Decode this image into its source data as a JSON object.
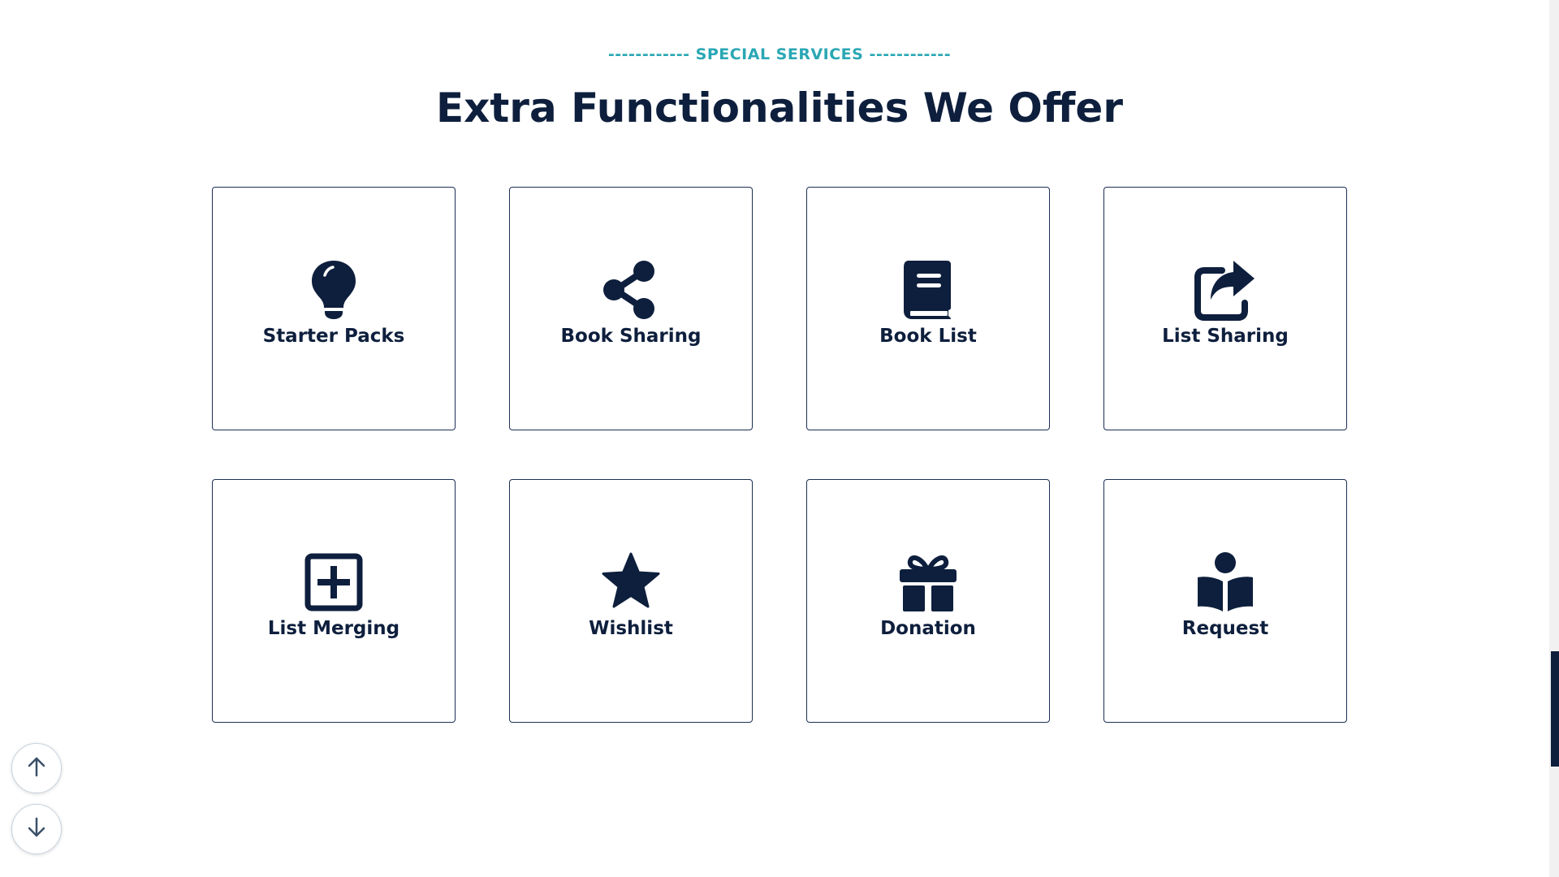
{
  "section": {
    "eyebrow": "------------ SPECIAL SERVICES ------------",
    "title": "Extra Functionalities We Offer"
  },
  "services": [
    {
      "label": "Starter Packs",
      "icon": "lightbulb-icon"
    },
    {
      "label": "Book Sharing",
      "icon": "share-icon"
    },
    {
      "label": "Book List",
      "icon": "book-icon"
    },
    {
      "label": "List Sharing",
      "icon": "share-square-icon"
    },
    {
      "label": "List Merging",
      "icon": "plus-square-icon"
    },
    {
      "label": "Wishlist",
      "icon": "star-icon"
    },
    {
      "label": "Donation",
      "icon": "gift-icon"
    },
    {
      "label": "Request",
      "icon": "book-reader-icon"
    }
  ],
  "colors": {
    "accent": "#2aa7b4",
    "primary": "#0e1f3d",
    "border": "#1c2f55"
  },
  "scroll_controls": {
    "up_icon": "arrow-up-icon",
    "down_icon": "arrow-down-icon"
  }
}
